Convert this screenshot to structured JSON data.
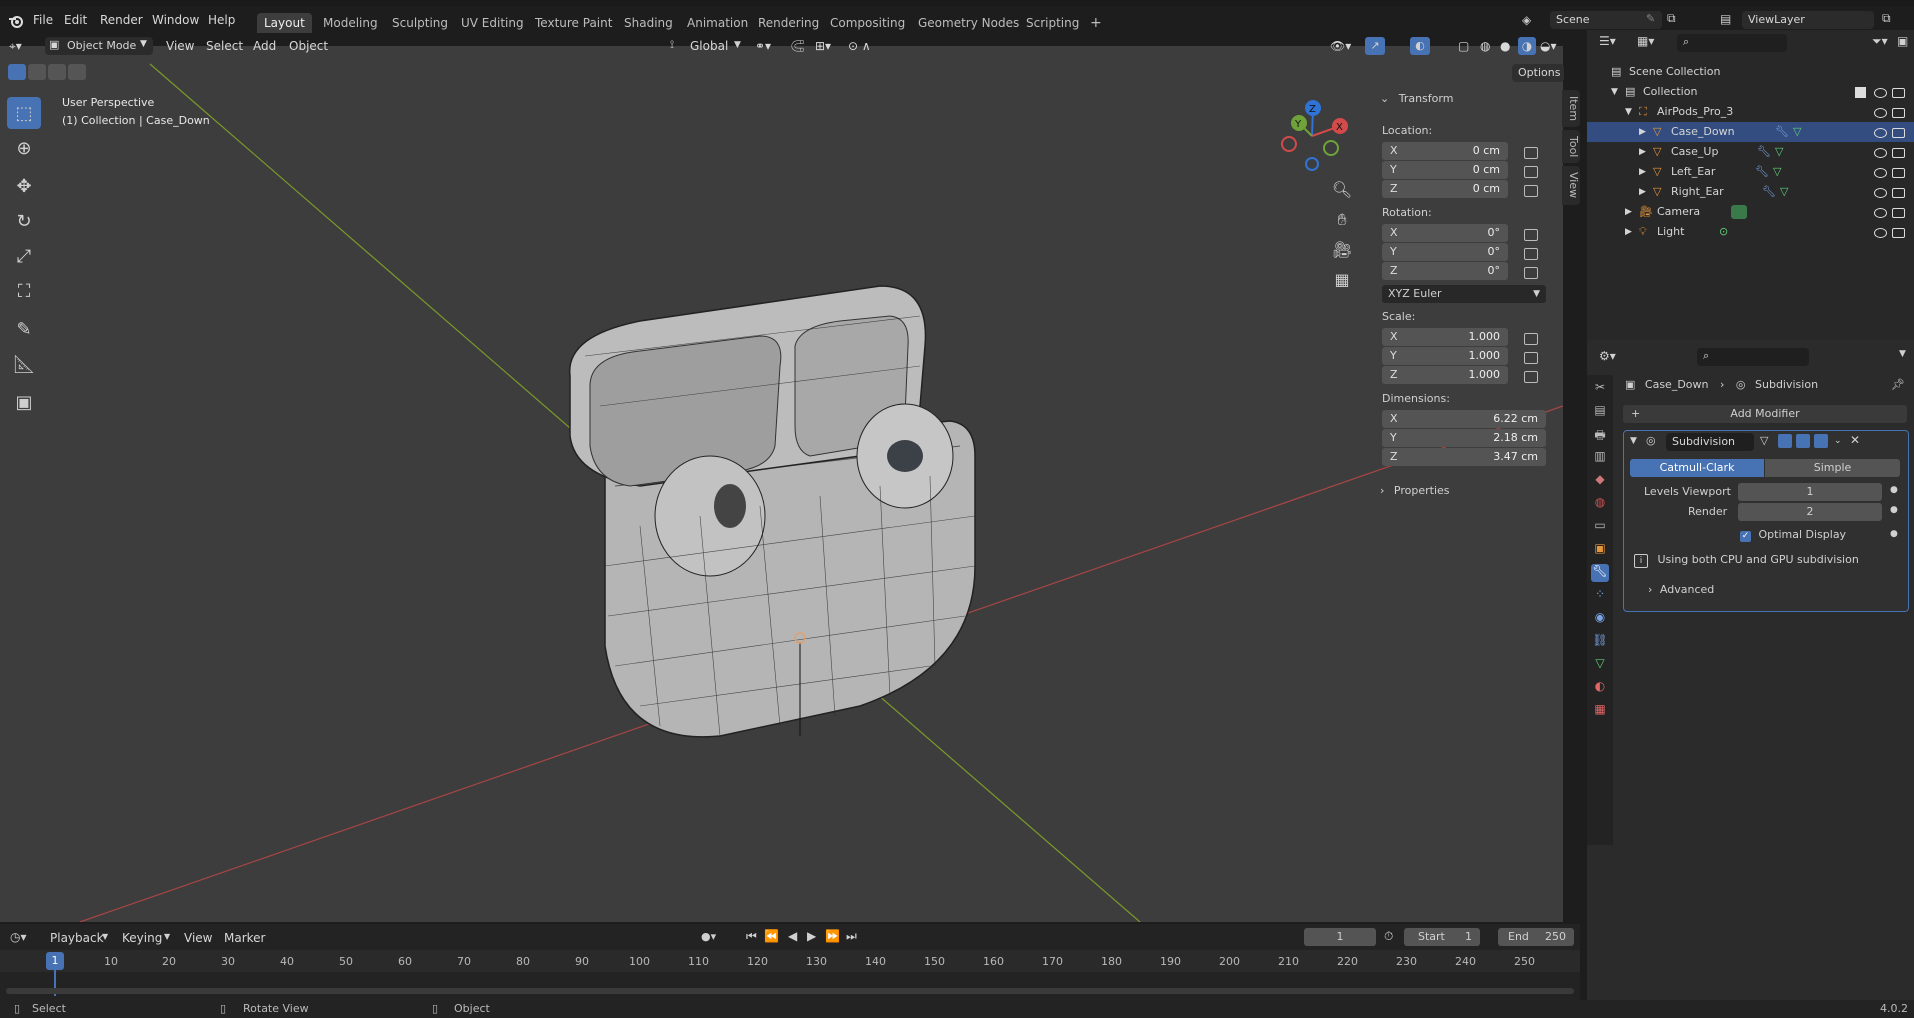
{
  "menus": [
    "File",
    "Edit",
    "Render",
    "Window",
    "Help"
  ],
  "workspaces": [
    "Layout",
    "Modeling",
    "Sculpting",
    "UV Editing",
    "Texture Paint",
    "Shading",
    "Animation",
    "Rendering",
    "Compositing",
    "Geometry Nodes",
    "Scripting"
  ],
  "active_workspace": "Layout",
  "scene_name": "Scene",
  "view_layer": "ViewLayer",
  "viewport": {
    "mode": "Object Mode",
    "menus": [
      "View",
      "Select",
      "Add",
      "Object"
    ],
    "transform_orientation": "Global",
    "options_label": "Options",
    "info_line1": "User Perspective",
    "info_line2": "(1) Collection | Case_Down"
  },
  "npanel": {
    "tabs": [
      "Item",
      "Tool",
      "View"
    ],
    "transform_title": "Transform",
    "location_label": "Location:",
    "location": [
      {
        "axis": "X",
        "value": "0 cm"
      },
      {
        "axis": "Y",
        "value": "0 cm"
      },
      {
        "axis": "Z",
        "value": "0 cm"
      }
    ],
    "rotation_label": "Rotation:",
    "rotation": [
      {
        "axis": "X",
        "value": "0°"
      },
      {
        "axis": "Y",
        "value": "0°"
      },
      {
        "axis": "Z",
        "value": "0°"
      }
    ],
    "rotation_mode": "XYZ Euler",
    "scale_label": "Scale:",
    "scale": [
      {
        "axis": "X",
        "value": "1.000"
      },
      {
        "axis": "Y",
        "value": "1.000"
      },
      {
        "axis": "Z",
        "value": "1.000"
      }
    ],
    "dimensions_label": "Dimensions:",
    "dimensions": [
      {
        "axis": "X",
        "value": "6.22 cm"
      },
      {
        "axis": "Y",
        "value": "2.18 cm"
      },
      {
        "axis": "Z",
        "value": "3.47 cm"
      }
    ],
    "properties_title": "Properties"
  },
  "outliner": {
    "rows": [
      {
        "label": "Scene Collection"
      },
      {
        "label": "Collection"
      },
      {
        "label": "AirPods_Pro_3"
      },
      {
        "label": "Case_Down"
      },
      {
        "label": "Case_Up"
      },
      {
        "label": "Left_Ear"
      },
      {
        "label": "Right_Ear"
      },
      {
        "label": "Camera"
      },
      {
        "label": "Light"
      }
    ]
  },
  "properties": {
    "breadcrumb_object": "Case_Down",
    "breadcrumb_modifier": "Subdivision",
    "add_modifier": "Add Modifier",
    "modifier_name": "Subdivision",
    "mode_catmull": "Catmull-Clark",
    "mode_simple": "Simple",
    "levels_viewport_label": "Levels Viewport",
    "levels_viewport_value": "1",
    "render_label": "Render",
    "render_value": "2",
    "optimal_display": "Optimal Display",
    "info_text": "Using both CPU and GPU subdivision",
    "advanced": "Advanced"
  },
  "timeline": {
    "menus": [
      "Playback",
      "Keying",
      "View",
      "Marker"
    ],
    "current_frame": "1",
    "start_label": "Start",
    "start_value": "1",
    "end_label": "End",
    "end_value": "250",
    "playhead": "1",
    "ticks": [
      "10",
      "20",
      "30",
      "40",
      "50",
      "60",
      "70",
      "80",
      "90",
      "100",
      "110",
      "120",
      "130",
      "140",
      "150",
      "160",
      "170",
      "180",
      "190",
      "200",
      "210",
      "220",
      "230",
      "240",
      "250"
    ]
  },
  "status": {
    "select": "Select",
    "rotate": "Rotate View",
    "object": "Object",
    "version": "4.0.2"
  }
}
